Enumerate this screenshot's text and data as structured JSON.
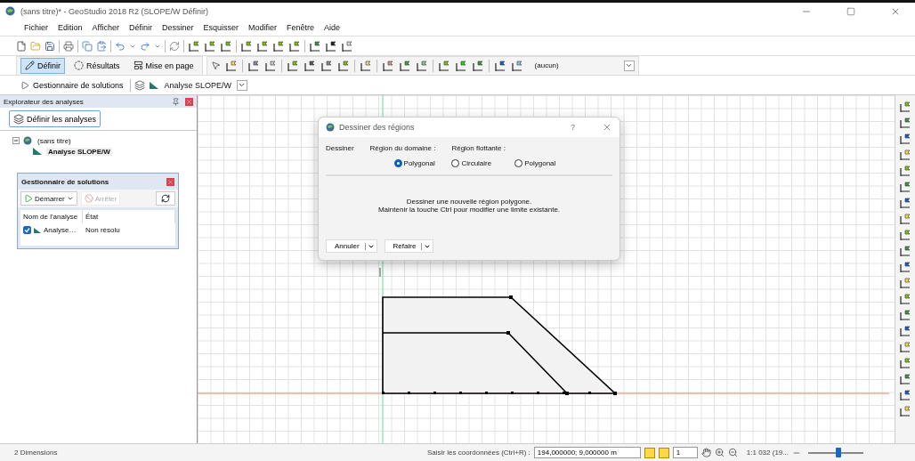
{
  "window": {
    "title": "(sans titre)* - GeoStudio 2018 R2 (SLOPE/W Définir)"
  },
  "menu": [
    "Fichier",
    "Edition",
    "Afficher",
    "Définir",
    "Dessiner",
    "Esquisser",
    "Modifier",
    "Fenêtre",
    "Aide"
  ],
  "modes": [
    {
      "label": "Définir",
      "selected": true
    },
    {
      "label": "Résultats",
      "selected": false
    },
    {
      "label": "Mise en page",
      "selected": false
    }
  ],
  "region_combo": {
    "value": "(aucun)"
  },
  "analysis_bar": {
    "manager_button": "Gestionnaire de solutions",
    "analysis_combo": "Analyse SLOPE/W"
  },
  "explorer": {
    "title": "Explorateur des analyses",
    "define_button": "Définir les analyses",
    "tree": [
      {
        "label": "(sans titre)",
        "expanded": true,
        "children": [
          {
            "label": "Analyse SLOPE/W",
            "selected": true
          }
        ]
      }
    ]
  },
  "solution_manager": {
    "title": "Gestionnaire de solutions",
    "start_button": {
      "label": "Démarrer",
      "disabled": false
    },
    "stop_button": {
      "label": "Arrêter",
      "disabled": true
    },
    "columns": [
      "Nom de l'analyse",
      "État"
    ],
    "rows": [
      {
        "checked": true,
        "name": "Analyse…",
        "state": "Non résolu"
      }
    ]
  },
  "dialog": {
    "title": "Dessiner des régions",
    "help": "?",
    "draw_label": "Dessiner",
    "groups": [
      {
        "label": "Région du domaine :",
        "options": [
          {
            "label": "Polygonal",
            "selected": true
          }
        ]
      },
      {
        "label": "Région flottante :",
        "options": [
          {
            "label": "Circulaire",
            "selected": false
          },
          {
            "label": "Polygonal",
            "selected": false
          }
        ]
      }
    ],
    "message": [
      "Dessiner une nouvelle région polygone.",
      "Maintenir la touche Ctrl pour modifier une limite existante."
    ],
    "buttons": [
      "Annuler",
      "Refaire"
    ]
  },
  "status_bar": {
    "mode": "2 Dimensions",
    "coord_label": "Saisir les coordonnées (Ctrl+R) :",
    "coord_value": "194,000000; 9,000000 m",
    "snap_value": "1",
    "scale": "1:1 032 (19...",
    "zoom": {
      "level": 0.55
    }
  }
}
